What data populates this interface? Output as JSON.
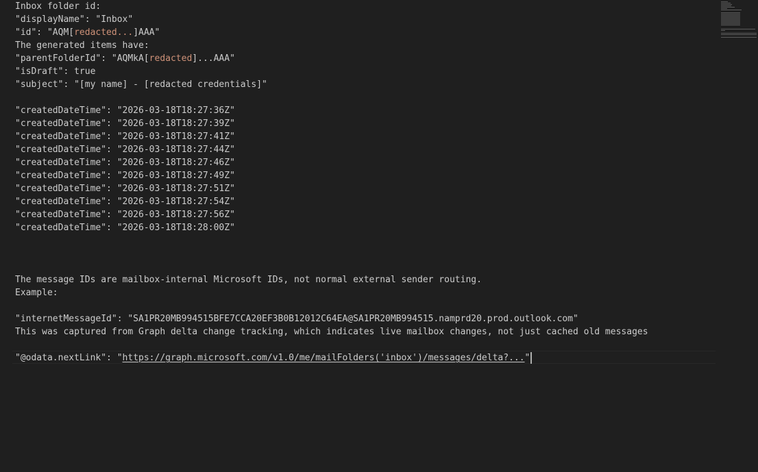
{
  "editor": {
    "lines": {
      "l1": "Inbox folder id:",
      "l2": "\"displayName\": \"Inbox\"",
      "l3_pre": "\"id\": \"AQM[",
      "l3_red": "redacted...",
      "l3_post": "]AAA\"",
      "l4": "The generated items have:",
      "l5_pre": "\"parentFolderId\": \"AQMkA[",
      "l5_red": "redacted",
      "l5_post": "]...AAA\"",
      "l6": "\"isDraft\": true",
      "l7": "\"subject\": \"[my name] - [redacted credentials]\"",
      "created": [
        "\"createdDateTime\": \"2026-03-18T18:27:36Z\"",
        "\"createdDateTime\": \"2026-03-18T18:27:39Z\"",
        "\"createdDateTime\": \"2026-03-18T18:27:41Z\"",
        "\"createdDateTime\": \"2026-03-18T18:27:44Z\"",
        "\"createdDateTime\": \"2026-03-18T18:27:46Z\"",
        "\"createdDateTime\": \"2026-03-18T18:27:49Z\"",
        "\"createdDateTime\": \"2026-03-18T18:27:51Z\"",
        "\"createdDateTime\": \"2026-03-18T18:27:54Z\"",
        "\"createdDateTime\": \"2026-03-18T18:27:56Z\"",
        "\"createdDateTime\": \"2026-03-18T18:28:00Z\""
      ],
      "l22": "The message IDs are mailbox-internal Microsoft IDs, not normal external sender routing.",
      "l23": "Example:",
      "l25": "\"internetMessageId\": \"SA1PR20MB994515BFE7CCA20EF3B0B12012C64EA@SA1PR20MB994515.namprd20.prod.outlook.com\"",
      "l26": "This was captured from Graph delta change tracking, which indicates live mailbox changes, not just cached old messages",
      "l28_pre": "\"@odata.nextLink\": \"",
      "l28_link": "https://graph.microsoft.com/v1.0/me/mailFolders('inbox')/messages/delta?...",
      "l28_post": "\""
    }
  }
}
